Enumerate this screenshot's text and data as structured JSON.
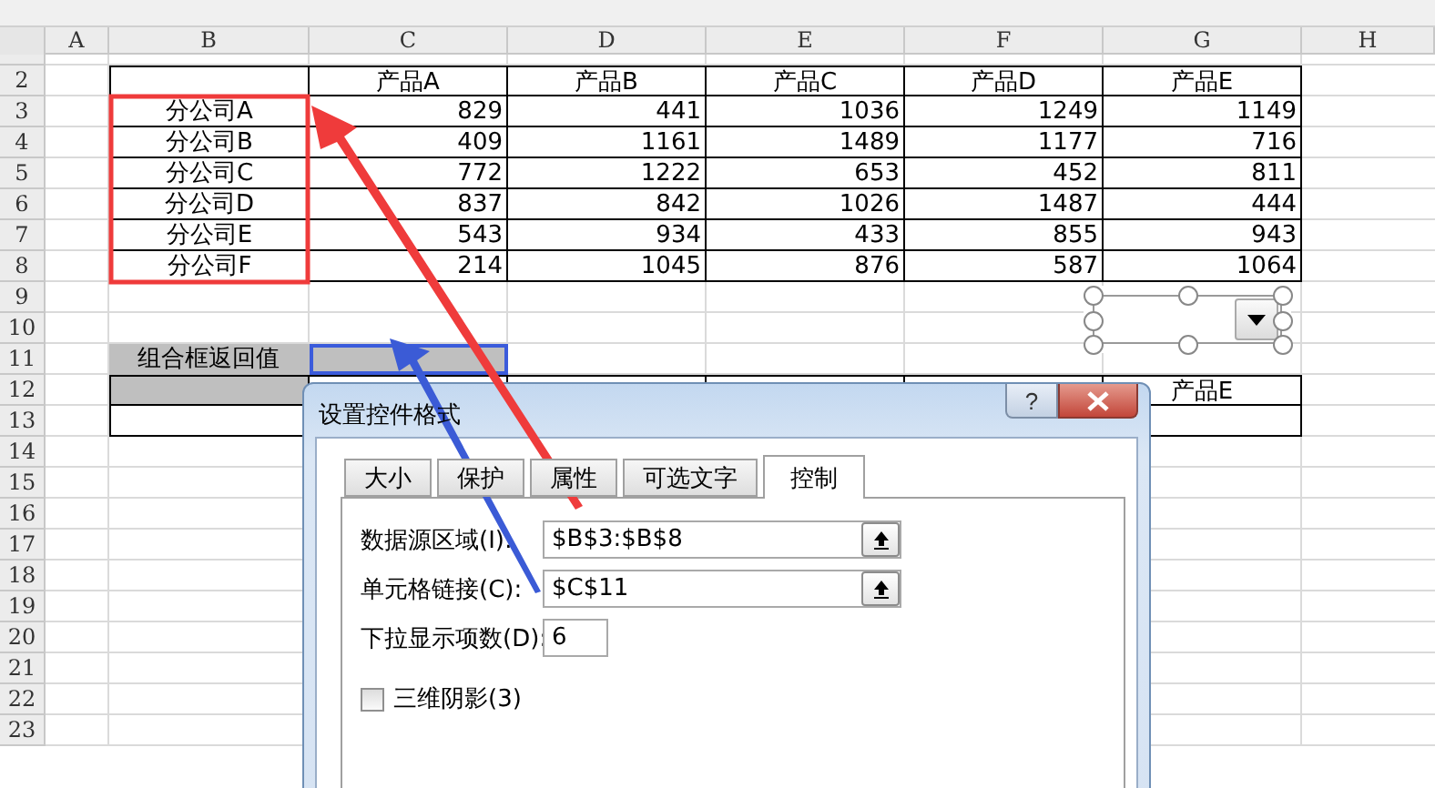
{
  "sheet": {
    "columns": [
      "A",
      "B",
      "C",
      "D",
      "E",
      "F",
      "G",
      "H"
    ],
    "rows": [
      {
        "number": "2",
        "kind": "header",
        "products": [
          "产品A",
          "产品B",
          "产品C",
          "产品D",
          "产品E"
        ]
      },
      {
        "number": "3",
        "kind": "data",
        "label": "分公司A",
        "values": [
          "829",
          "441",
          "1036",
          "1249",
          "1149"
        ]
      },
      {
        "number": "4",
        "kind": "data",
        "label": "分公司B",
        "values": [
          "409",
          "1161",
          "1489",
          "1177",
          "716"
        ]
      },
      {
        "number": "5",
        "kind": "data",
        "label": "分公司C",
        "values": [
          "772",
          "1222",
          "653",
          "452",
          "811"
        ]
      },
      {
        "number": "6",
        "kind": "data",
        "label": "分公司D",
        "values": [
          "837",
          "842",
          "1026",
          "1487",
          "444"
        ]
      },
      {
        "number": "7",
        "kind": "data",
        "label": "分公司E",
        "values": [
          "543",
          "934",
          "433",
          "855",
          "943"
        ]
      },
      {
        "number": "8",
        "kind": "data",
        "label": "分公司F",
        "values": [
          "214",
          "1045",
          "876",
          "587",
          "1064"
        ]
      },
      {
        "number": "9",
        "kind": "blank"
      },
      {
        "number": "10",
        "kind": "blank"
      },
      {
        "number": "11",
        "kind": "input",
        "label": "组合框返回值",
        "selected": true
      },
      {
        "number": "12",
        "kind": "subheader",
        "products": [
          "产品E"
        ]
      },
      {
        "number": "13",
        "kind": "bordered"
      },
      {
        "number": "14",
        "kind": "blank"
      },
      {
        "number": "15",
        "kind": "blank"
      },
      {
        "number": "16",
        "kind": "blank"
      },
      {
        "number": "17",
        "kind": "blank"
      },
      {
        "number": "18",
        "kind": "blank"
      },
      {
        "number": "19",
        "kind": "blank"
      },
      {
        "number": "20",
        "kind": "blank"
      },
      {
        "number": "21",
        "kind": "blank"
      },
      {
        "number": "22",
        "kind": "blank"
      },
      {
        "number": "23",
        "kind": "blank"
      }
    ]
  },
  "combo_box": {
    "selected": true
  },
  "dialog": {
    "title": "设置控件格式",
    "help": "?",
    "tabs": [
      {
        "label": "大小",
        "selected": false
      },
      {
        "label": "保护",
        "selected": false
      },
      {
        "label": "属性",
        "selected": false
      },
      {
        "label": "可选文字",
        "selected": false
      },
      {
        "label": "控制",
        "selected": true
      }
    ],
    "fields": [
      {
        "label": "数据源区域(I):",
        "value": "$B$3:$B$8",
        "kind": "range"
      },
      {
        "label": "单元格链接(C):",
        "value": "$C$11",
        "kind": "range"
      },
      {
        "label": "下拉显示项数(D):",
        "value": "6",
        "kind": "number"
      }
    ],
    "checkbox": {
      "label": "三维阴影(3)",
      "checked": false
    }
  }
}
